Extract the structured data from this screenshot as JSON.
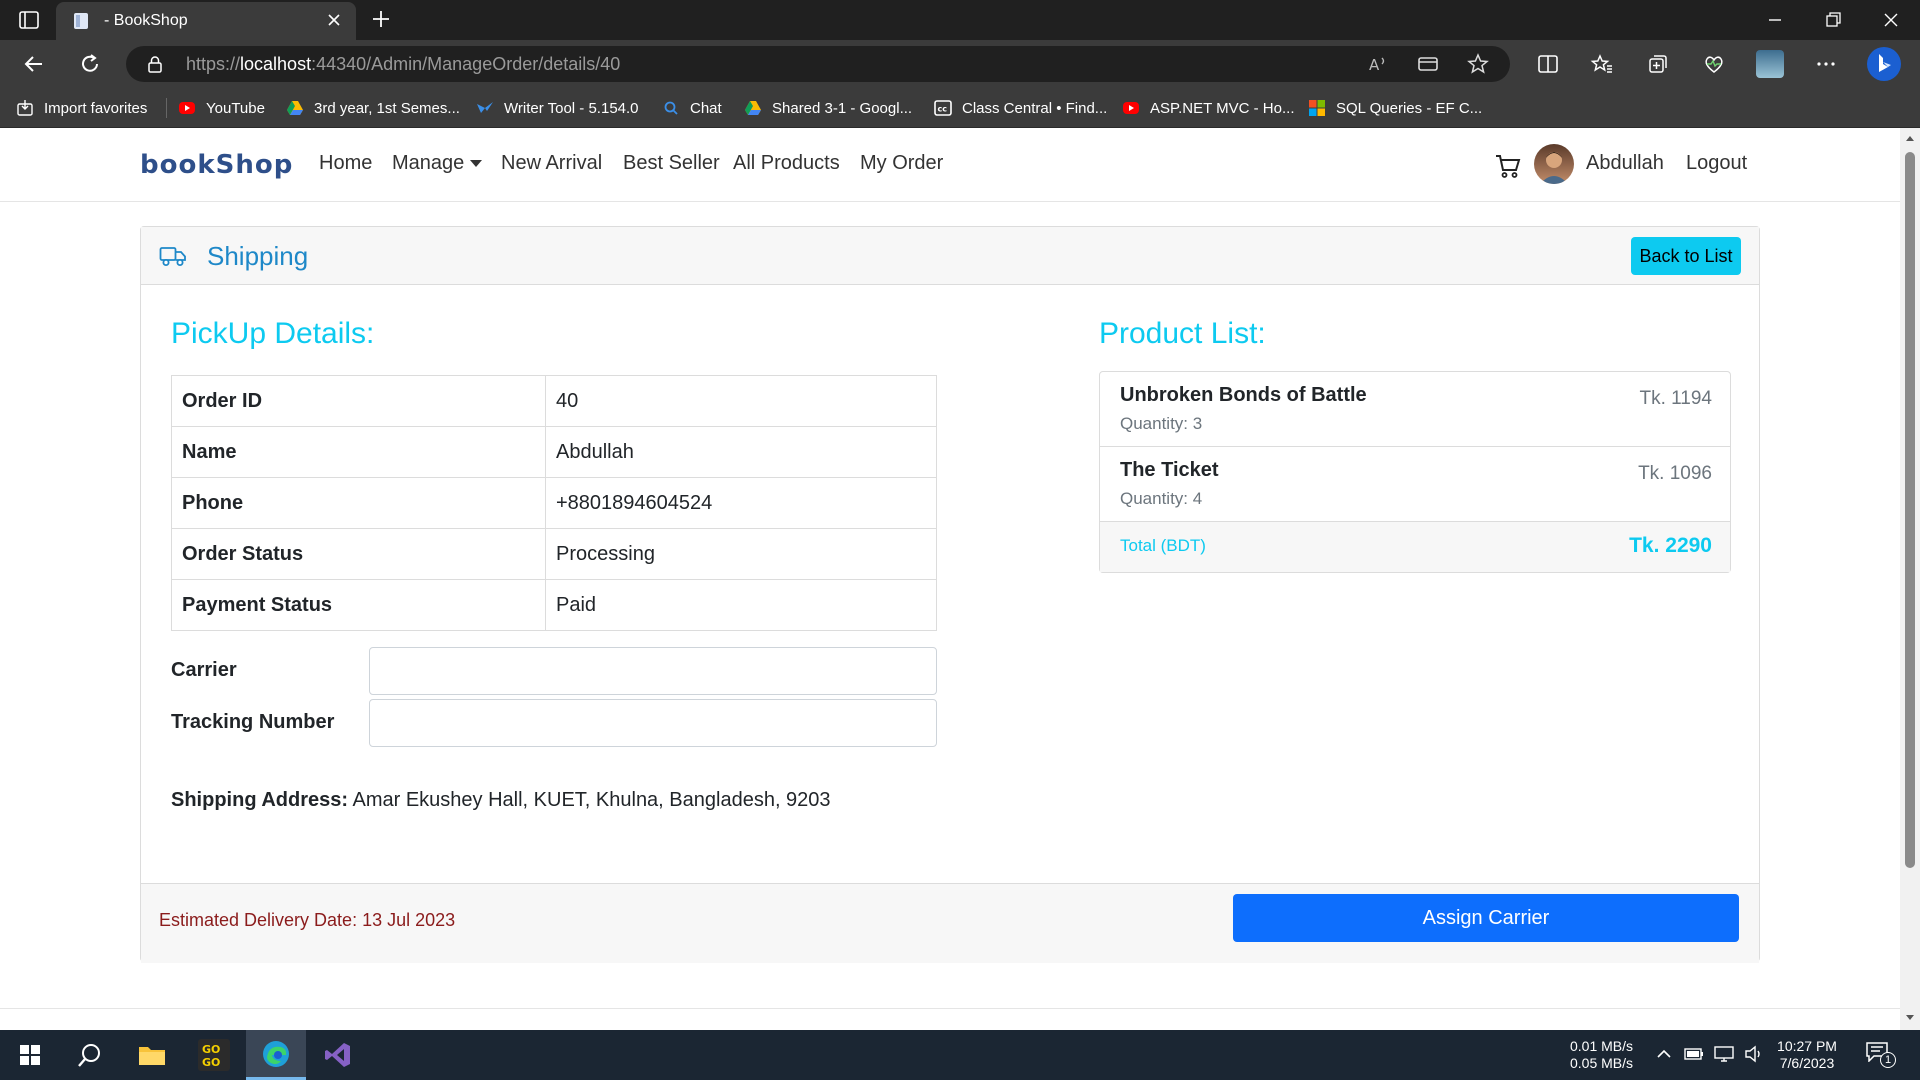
{
  "browser": {
    "tab_title": "- BookShop",
    "url_scheme": "https://",
    "url_host": "localhost",
    "url_rest": ":44340/Admin/ManageOrder/details/40",
    "favorites": [
      {
        "label": "Import favorites",
        "icon": "import-icon"
      },
      {
        "label": "YouTube",
        "icon": "youtube-icon"
      },
      {
        "label": "3rd year, 1st Semes...",
        "icon": "drive-icon"
      },
      {
        "label": "Writer Tool - 5.154.0",
        "icon": "writer-icon"
      },
      {
        "label": "Chat",
        "icon": "search-icon"
      },
      {
        "label": "Shared 3-1 - Googl...",
        "icon": "drive-icon"
      },
      {
        "label": "Class Central • Find...",
        "icon": "classcentral-icon"
      },
      {
        "label": "ASP.NET MVC - Ho...",
        "icon": "youtube-icon"
      },
      {
        "label": "SQL Queries - EF C...",
        "icon": "microsoft-icon"
      }
    ]
  },
  "navbar": {
    "brand": "bookShop",
    "links": [
      "Home",
      "Manage",
      "New Arrival",
      "Best Seller",
      "All Products",
      "My Order"
    ],
    "user": "Abdullah",
    "logout": "Logout"
  },
  "card": {
    "header_title": "Shipping",
    "back_button": "Back to List",
    "pickup_title": "PickUp Details:",
    "details": [
      {
        "label": "Order ID",
        "value": "40"
      },
      {
        "label": "Name",
        "value": "Abdullah"
      },
      {
        "label": "Phone",
        "value": "+8801894604524"
      },
      {
        "label": "Order Status",
        "value": "Processing"
      },
      {
        "label": "Payment Status",
        "value": "Paid"
      }
    ],
    "carrier_label": "Carrier",
    "carrier_value": "",
    "tracking_label": "Tracking Number",
    "tracking_value": "",
    "shipping_address_label": "Shipping Address:",
    "shipping_address": "Amar Ekushey Hall, KUET, Khulna, Bangladesh, 9203",
    "product_title": "Product List:",
    "products": [
      {
        "name": "Unbroken Bonds of Battle",
        "quantity": "Quantity: 3",
        "price": "Tk. 1194"
      },
      {
        "name": "The Ticket",
        "quantity": "Quantity: 4",
        "price": "Tk. 1096"
      }
    ],
    "total_label": "Total (BDT)",
    "total_value": "Tk. 2290",
    "estimated_delivery": "Estimated Delivery Date: 13 Jul 2023",
    "assign_button": "Assign Carrier"
  },
  "taskbar": {
    "net_up": "0.01 MB/s",
    "net_down": "0.05 MB/s",
    "time": "10:27 PM",
    "date": "7/6/2023",
    "notification_count": "1"
  },
  "colors": {
    "accent_cyan": "#0dcaf0",
    "primary_blue": "#0d6efd",
    "header_blue": "#1e88c8",
    "eta_red": "#8b1c1c"
  }
}
